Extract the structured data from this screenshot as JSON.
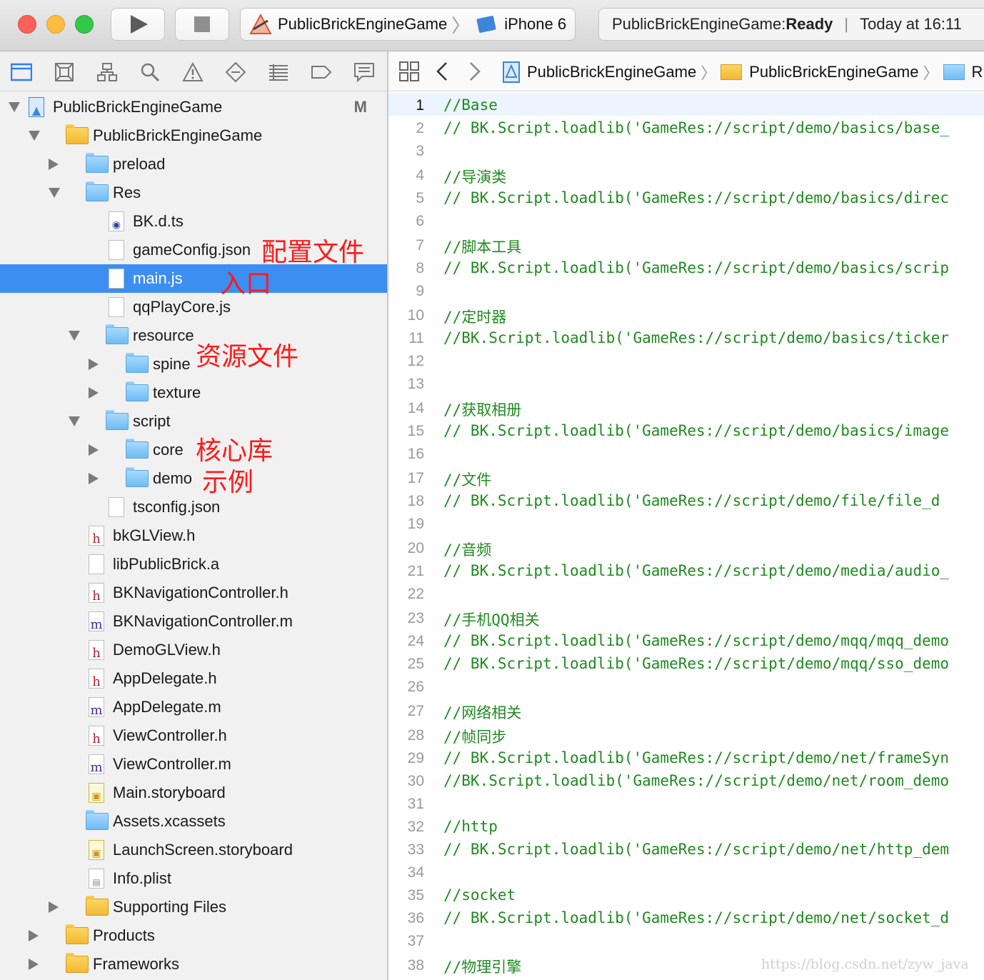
{
  "toolbar": {
    "scheme": {
      "project": "PublicBrickEngineGame",
      "device": "iPhone 6"
    },
    "activity": {
      "status_prefix": "PublicBrickEngineGame: ",
      "status": "Ready",
      "time": "Today at 16:11"
    }
  },
  "navigator": {
    "icons": [
      "project-navigator-icon",
      "source-control-icon",
      "symbol-navigator-icon",
      "find-navigator-icon",
      "issue-navigator-icon",
      "test-navigator-icon",
      "debug-navigator-icon",
      "breakpoint-navigator-icon",
      "report-navigator-icon"
    ],
    "tree": [
      {
        "name": "PublicBrickEngineGame",
        "level": 0,
        "disc": "open",
        "icon": "project",
        "badge": "M"
      },
      {
        "name": "PublicBrickEngineGame",
        "level": 1,
        "disc": "open",
        "icon": "folder-yellow"
      },
      {
        "name": "preload",
        "level": 2,
        "disc": "closed",
        "icon": "folder-blue"
      },
      {
        "name": "Res",
        "level": 2,
        "disc": "open",
        "icon": "folder-blue"
      },
      {
        "name": "BK.d.ts",
        "level": 3,
        "disc": "",
        "icon": "ts"
      },
      {
        "name": "gameConfig.json",
        "level": 3,
        "disc": "",
        "icon": "doc"
      },
      {
        "name": "main.js",
        "level": 3,
        "disc": "",
        "icon": "doc",
        "selected": true
      },
      {
        "name": "qqPlayCore.js",
        "level": 3,
        "disc": "",
        "icon": "doc"
      },
      {
        "name": "resource",
        "level": 3,
        "disc": "open",
        "icon": "folder-blue"
      },
      {
        "name": "spine",
        "level": 4,
        "disc": "closed",
        "icon": "folder-blue"
      },
      {
        "name": "texture",
        "level": 4,
        "disc": "closed",
        "icon": "folder-blue"
      },
      {
        "name": "script",
        "level": 3,
        "disc": "open",
        "icon": "folder-blue"
      },
      {
        "name": "core",
        "level": 4,
        "disc": "closed",
        "icon": "folder-blue"
      },
      {
        "name": "demo",
        "level": 4,
        "disc": "closed",
        "icon": "folder-blue"
      },
      {
        "name": "tsconfig.json",
        "level": 3,
        "disc": "",
        "icon": "doc"
      },
      {
        "name": "bkGLView.h",
        "level": 2,
        "disc": "",
        "icon": "h"
      },
      {
        "name": "libPublicBrick.a",
        "level": 2,
        "disc": "",
        "icon": "doc"
      },
      {
        "name": "BKNavigationController.h",
        "level": 2,
        "disc": "",
        "icon": "h"
      },
      {
        "name": "BKNavigationController.m",
        "level": 2,
        "disc": "",
        "icon": "m"
      },
      {
        "name": "DemoGLView.h",
        "level": 2,
        "disc": "",
        "icon": "h"
      },
      {
        "name": "AppDelegate.h",
        "level": 2,
        "disc": "",
        "icon": "h"
      },
      {
        "name": "AppDelegate.m",
        "level": 2,
        "disc": "",
        "icon": "m"
      },
      {
        "name": "ViewController.h",
        "level": 2,
        "disc": "",
        "icon": "h"
      },
      {
        "name": "ViewController.m",
        "level": 2,
        "disc": "",
        "icon": "m"
      },
      {
        "name": "Main.storyboard",
        "level": 2,
        "disc": "",
        "icon": "storyboard"
      },
      {
        "name": "Assets.xcassets",
        "level": 2,
        "disc": "",
        "icon": "folder-blue"
      },
      {
        "name": "LaunchScreen.storyboard",
        "level": 2,
        "disc": "",
        "icon": "storyboard"
      },
      {
        "name": "Info.plist",
        "level": 2,
        "disc": "",
        "icon": "plist"
      },
      {
        "name": "Supporting Files",
        "level": 2,
        "disc": "closed",
        "icon": "folder-yellow"
      },
      {
        "name": "Products",
        "level": 1,
        "disc": "closed",
        "icon": "folder-yellow"
      },
      {
        "name": "Frameworks",
        "level": 1,
        "disc": "closed",
        "icon": "folder-yellow"
      }
    ]
  },
  "annotations": {
    "config_file": "配置文件",
    "entry": "入口",
    "resource_file": "资源文件",
    "core_lib": "核心库",
    "example": "示例"
  },
  "jumpbar": {
    "crumbs": [
      "PublicBrickEngineGame",
      "PublicBrickEngineGame",
      "R"
    ]
  },
  "editor": {
    "lines": [
      {
        "n": "1",
        "t": "//Base"
      },
      {
        "n": "2",
        "t": "// BK.Script.loadlib('GameRes://script/demo/basics/base_"
      },
      {
        "n": "3",
        "t": ""
      },
      {
        "n": "4",
        "t": "//导演类"
      },
      {
        "n": "5",
        "t": "// BK.Script.loadlib('GameRes://script/demo/basics/direc"
      },
      {
        "n": "6",
        "t": ""
      },
      {
        "n": "7",
        "t": "//脚本工具"
      },
      {
        "n": "8",
        "t": "// BK.Script.loadlib('GameRes://script/demo/basics/scrip"
      },
      {
        "n": "9",
        "t": ""
      },
      {
        "n": "10",
        "t": "//定时器"
      },
      {
        "n": "11",
        "t": "//BK.Script.loadlib('GameRes://script/demo/basics/ticker"
      },
      {
        "n": "12",
        "t": ""
      },
      {
        "n": "13",
        "t": ""
      },
      {
        "n": "14",
        "t": "//获取相册"
      },
      {
        "n": "15",
        "t": "// BK.Script.loadlib('GameRes://script/demo/basics/image"
      },
      {
        "n": "16",
        "t": ""
      },
      {
        "n": "17",
        "t": "//文件"
      },
      {
        "n": "18",
        "t": "//  BK.Script.loadlib('GameRes://script/demo/file/file_d"
      },
      {
        "n": "19",
        "t": ""
      },
      {
        "n": "20",
        "t": "//音频"
      },
      {
        "n": "21",
        "t": "// BK.Script.loadlib('GameRes://script/demo/media/audio_"
      },
      {
        "n": "22",
        "t": ""
      },
      {
        "n": "23",
        "t": "//手机QQ相关"
      },
      {
        "n": "24",
        "t": "// BK.Script.loadlib('GameRes://script/demo/mqq/mqq_demo"
      },
      {
        "n": "25",
        "t": "// BK.Script.loadlib('GameRes://script/demo/mqq/sso_demo"
      },
      {
        "n": "26",
        "t": ""
      },
      {
        "n": "27",
        "t": "//网络相关"
      },
      {
        "n": "28",
        "t": "//帧同步"
      },
      {
        "n": "29",
        "t": "// BK.Script.loadlib('GameRes://script/demo/net/frameSyn"
      },
      {
        "n": "30",
        "t": "//BK.Script.loadlib('GameRes://script/demo/net/room_demo"
      },
      {
        "n": "31",
        "t": ""
      },
      {
        "n": "32",
        "t": "//http"
      },
      {
        "n": "33",
        "t": "// BK.Script.loadlib('GameRes://script/demo/net/http_dem"
      },
      {
        "n": "34",
        "t": ""
      },
      {
        "n": "35",
        "t": "//socket"
      },
      {
        "n": "36",
        "t": "// BK.Script.loadlib('GameRes://script/demo/net/socket_d"
      },
      {
        "n": "37",
        "t": ""
      },
      {
        "n": "38",
        "t": "//物理引擎"
      }
    ]
  },
  "watermark": "https://blog.csdn.net/zyw_java"
}
